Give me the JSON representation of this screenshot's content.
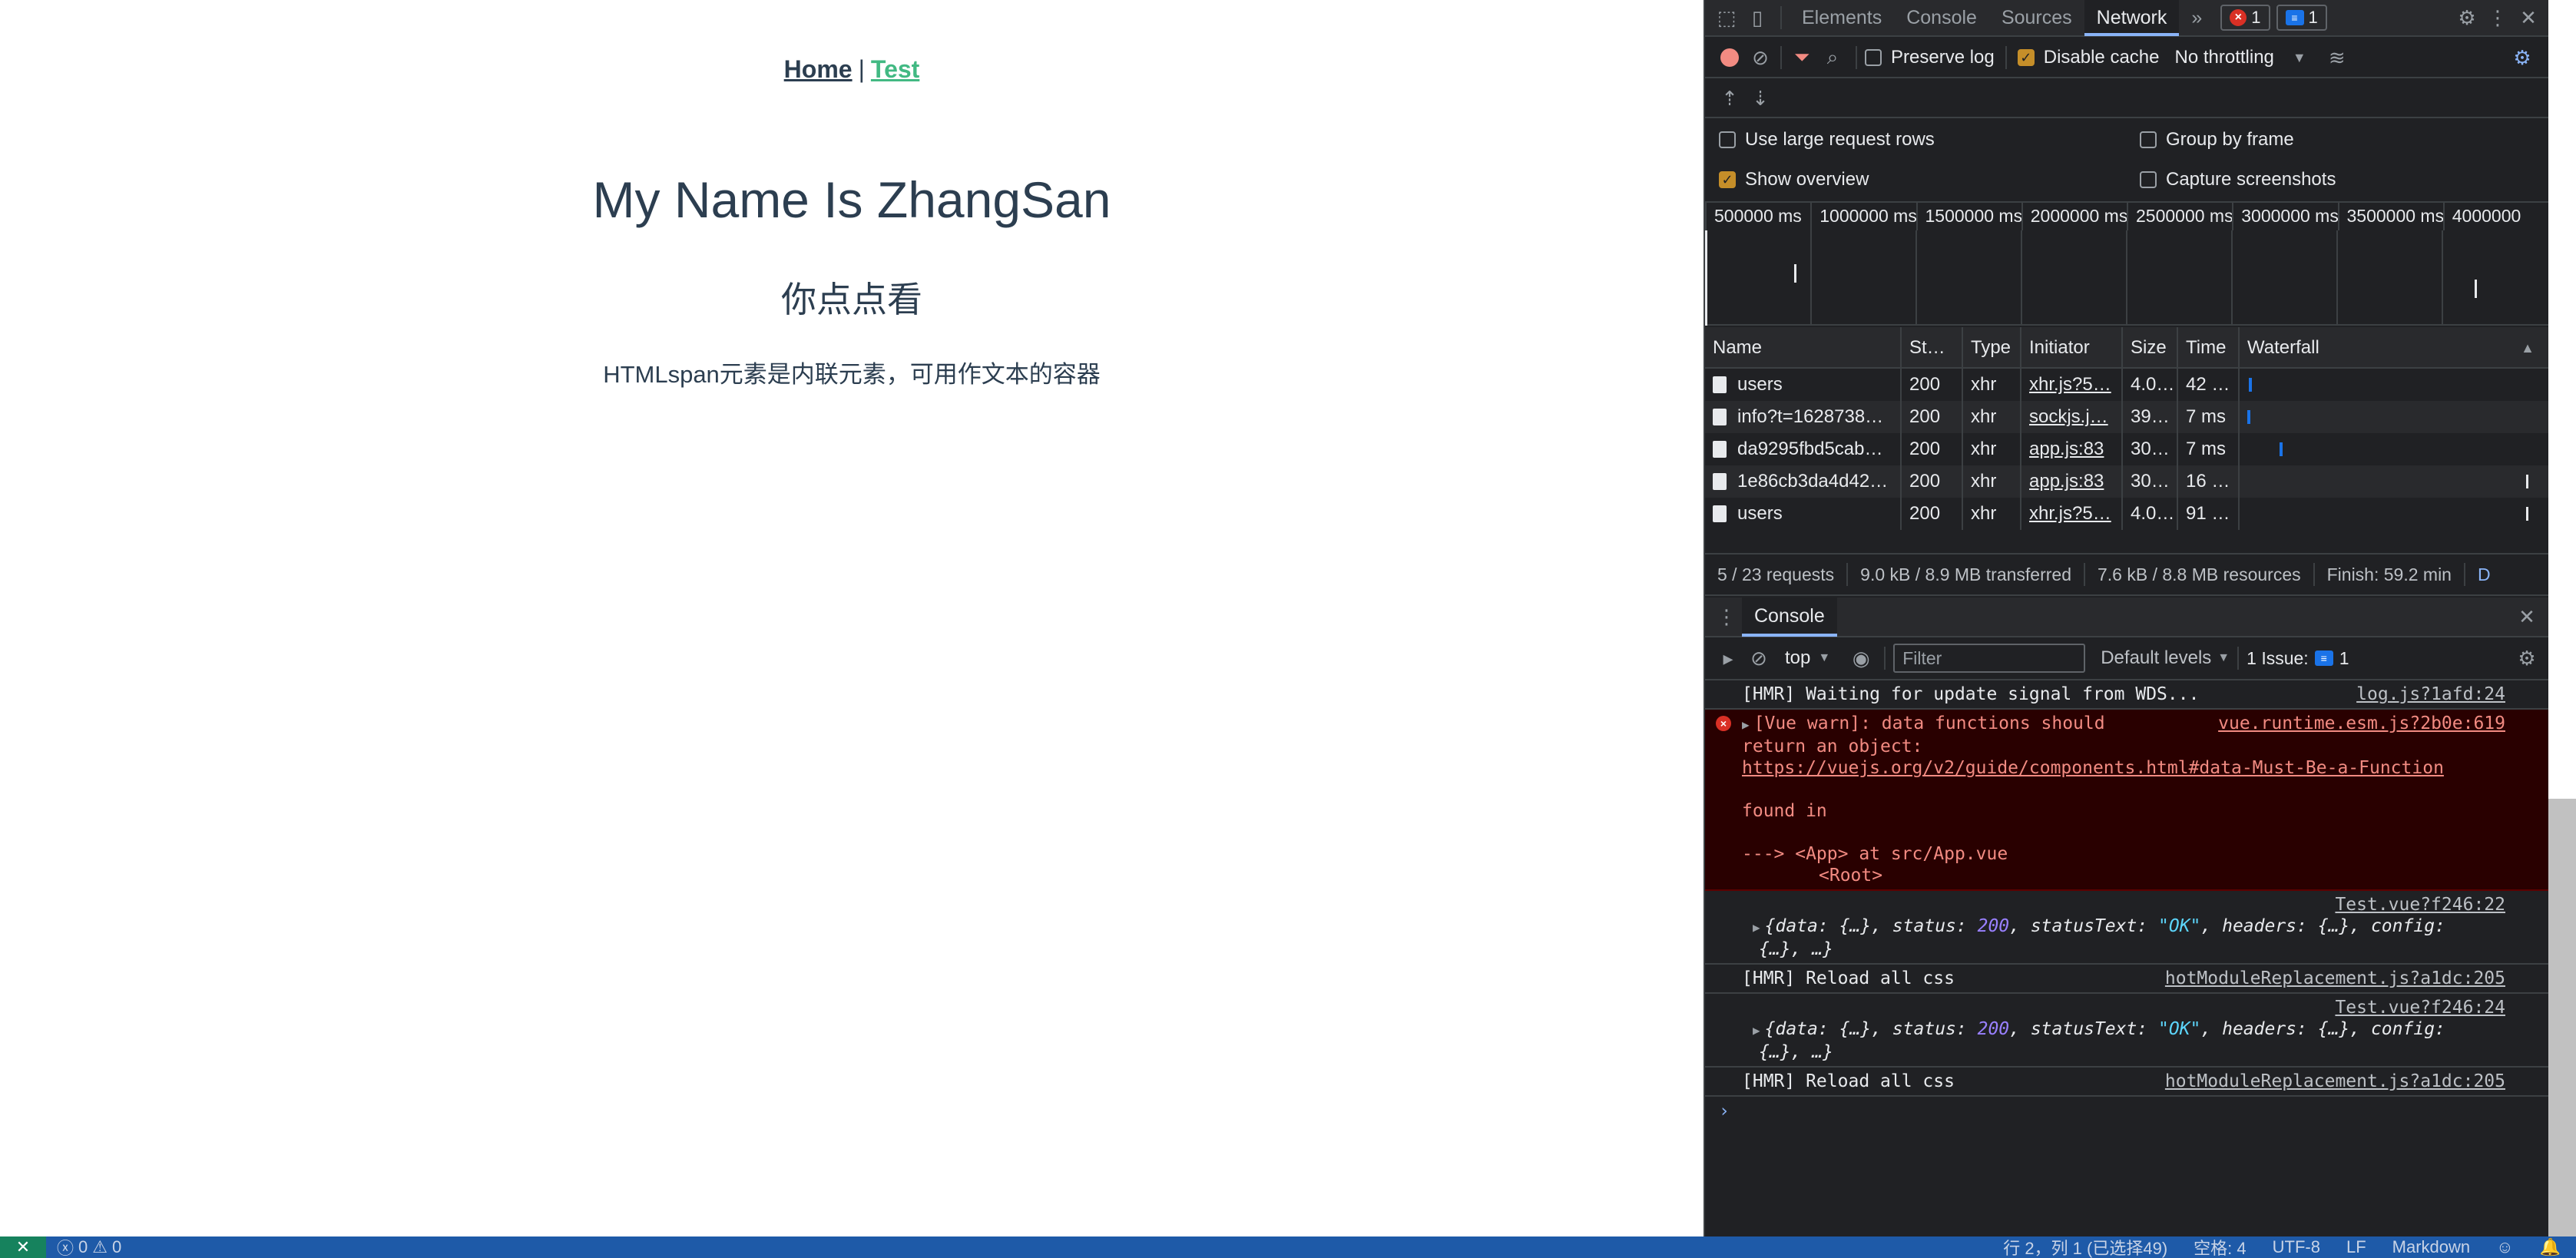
{
  "app": {
    "nav": {
      "home": "Home",
      "separator": "|",
      "test": "Test"
    },
    "title": "My Name Is ZhangSan",
    "subtitle": "你点点看",
    "paragraph": "HTMLspan元素是内联元素，可用作文本的容器"
  },
  "devtools": {
    "tabs": [
      "Elements",
      "Console",
      "Sources",
      "Network"
    ],
    "active_tab": "Network",
    "more": "»",
    "error_count": "1",
    "message_count": "1",
    "network_toolbar": {
      "preserve_log": "Preserve log",
      "disable_cache": "Disable cache",
      "throttling": "No throttling"
    },
    "options": {
      "large_rows": "Use large request rows",
      "group_by_frame": "Group by frame",
      "show_overview": "Show overview",
      "capture_screenshots": "Capture screenshots"
    },
    "overview_ticks": [
      "500000 ms",
      "1000000 ms",
      "1500000 ms",
      "2000000 ms",
      "2500000 ms",
      "3000000 ms",
      "3500000 ms",
      "4000000"
    ],
    "columns": [
      "Name",
      "St…",
      "Type",
      "Initiator",
      "Size",
      "Time",
      "Waterfall"
    ],
    "requests": [
      {
        "name": "users",
        "status": "200",
        "type": "xhr",
        "initiator": "xhr.js?5…",
        "size": "4.0…",
        "time": "42 …"
      },
      {
        "name": "info?t=1628738…",
        "status": "200",
        "type": "xhr",
        "initiator": "sockjs.j…",
        "size": "39…",
        "time": "7 ms"
      },
      {
        "name": "da9295fbd5cab…",
        "status": "200",
        "type": "xhr",
        "initiator": "app.js:83",
        "size": "30…",
        "time": "7 ms"
      },
      {
        "name": "1e86cb3da4d42…",
        "status": "200",
        "type": "xhr",
        "initiator": "app.js:83",
        "size": "30…",
        "time": "16 …"
      },
      {
        "name": "users",
        "status": "200",
        "type": "xhr",
        "initiator": "xhr.js?5…",
        "size": "4.0…",
        "time": "91 …"
      }
    ],
    "summary": {
      "requests": "5 / 23 requests",
      "transferred": "9.0 kB / 8.9 MB transferred",
      "resources": "7.6 kB / 8.8 MB resources",
      "finish": "Finish: 59.2 min",
      "extra": "D"
    },
    "drawer": {
      "tab": "Console",
      "context": "top",
      "filter_placeholder": "Filter",
      "levels": "Default levels",
      "issues_label": "1 Issue:",
      "issues_count": "1"
    },
    "console": {
      "m1_text": "[HMR] Waiting for update signal from WDS...",
      "m1_src": "log.js?1afd:24",
      "m2_line1": "[Vue warn]: data functions should",
      "m2_line2": "return an object:",
      "m2_link": "https://vuejs.org/v2/guide/components.html#data-Must-Be-a-Function",
      "m2_found": "found in",
      "m2_app": "---> <App> at src/App.vue",
      "m2_root": "<Root>",
      "m2_src": "vue.runtime.esm.js?2b0e:619",
      "m3_src": "Test.vue?f246:22",
      "m3_a": "{data: {…}, status: ",
      "m3_status": "200",
      "m3_b": ", statusText: ",
      "m3_ok": "\"OK\"",
      "m3_c": ", headers: {…}, config:",
      "m3_d": "{…}, …}",
      "m4_text": "[HMR] Reload all css",
      "m4_src": "hotModuleReplacement.js?a1dc:205",
      "m5_src": "Test.vue?f246:24",
      "m6_text": "[HMR] Reload all css",
      "m6_src": "hotModuleReplacement.js?a1dc:205",
      "prompt": "›"
    }
  },
  "statusbar": {
    "errors": "0",
    "warnings": "0",
    "cursor": "行 2，列 1 (已选择49)",
    "spaces": "空格: 4",
    "encoding": "UTF-8",
    "eol": "LF",
    "language": "Markdown"
  }
}
